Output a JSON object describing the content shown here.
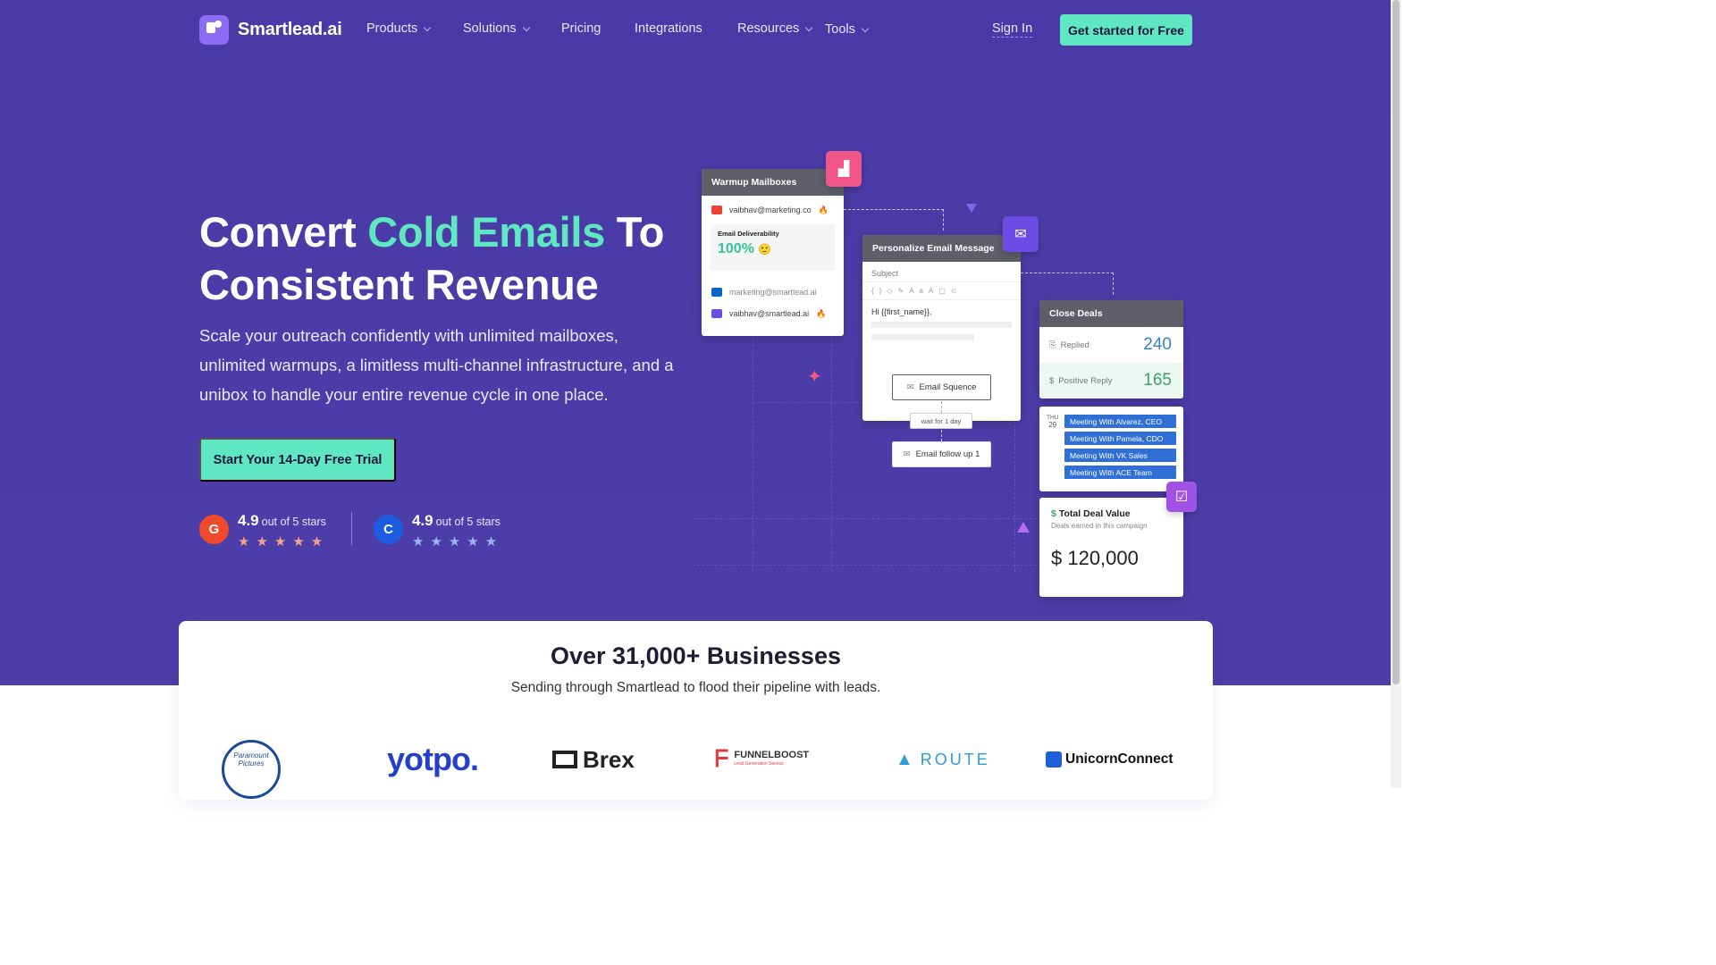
{
  "brand": {
    "name": "Smartlead.ai",
    "accent": "#5ee7c0",
    "hero_bg": "#4b3ba6"
  },
  "nav": {
    "items": [
      {
        "label": "Products",
        "dropdown": true
      },
      {
        "label": "Solutions",
        "dropdown": true
      },
      {
        "label": "Pricing",
        "dropdown": false
      },
      {
        "label": "Integrations",
        "dropdown": false
      },
      {
        "label": "Resources",
        "dropdown": true
      },
      {
        "label": "Tools",
        "dropdown": true
      }
    ],
    "sign_in": "Sign In",
    "cta": "Get started for Free"
  },
  "hero": {
    "headline_1": "Convert ",
    "headline_accent": "Cold Emails",
    "headline_2": " To",
    "headline_3": "Consistent Revenue",
    "subtext": "Scale your outreach confidently with unlimited mailboxes, unlimited warmups, a limitless multi-channel infrastructure, and a unibox to handle your entire revenue cycle in one place.",
    "cta": "Start Your 14-Day Free Trial",
    "ratings": [
      {
        "badge": "G",
        "score": "4.9",
        "outof": "out of 5 stars",
        "stars": "★★★★★",
        "star_color": "#f4a28c",
        "badge_color": "#ef4a2c"
      },
      {
        "badge": "C",
        "score": "4.9",
        "outof": "out of 5 stars",
        "stars": "★★★★★",
        "star_color": "#9fb4f2",
        "badge_color": "#1d5be0"
      }
    ]
  },
  "illustration": {
    "warmup": {
      "title": "Warmup Mailboxes",
      "mail1": "vaibhav@marketing.co",
      "deliverability_label": "Email Deliverability",
      "deliverability_value": "100%",
      "mail2": "marketing@smartlead.ai",
      "mail3": "vaibhav@smartlead.ai"
    },
    "personalize": {
      "title": "Personalize Email Message",
      "subject": "Subject",
      "body": "Hi {{first_name}},",
      "sequence": "Email Squence",
      "wait": "wait for 1 day",
      "followup": "Email follow up 1"
    },
    "close_deals": {
      "title": "Close Deals",
      "replied_label": "Replied",
      "replied_value": "240",
      "positive_label": "Positive Reply",
      "positive_value": "165"
    },
    "calendar": {
      "day": "THU",
      "date": "29",
      "meetings": [
        "Meeting With Alvarez, CEO",
        "Meeting With Pamela, CDO",
        "Meeting With VK Sales",
        "Meeting With ACE Team"
      ]
    },
    "deal_value": {
      "title": "Total Deal Value",
      "subtitle": "Deals earned in this campaign",
      "value": "$ 120,000"
    }
  },
  "social_proof": {
    "title": "Over 31,000+ Businesses",
    "subtitle": "Sending through Smartlead to flood their pipeline with leads.",
    "logos": [
      "Paramount Pictures",
      "yotpo.",
      "Brex",
      "FUNNELBOOST",
      "Lead Generation Service",
      "ROUTE",
      "UnicornConnect"
    ]
  }
}
